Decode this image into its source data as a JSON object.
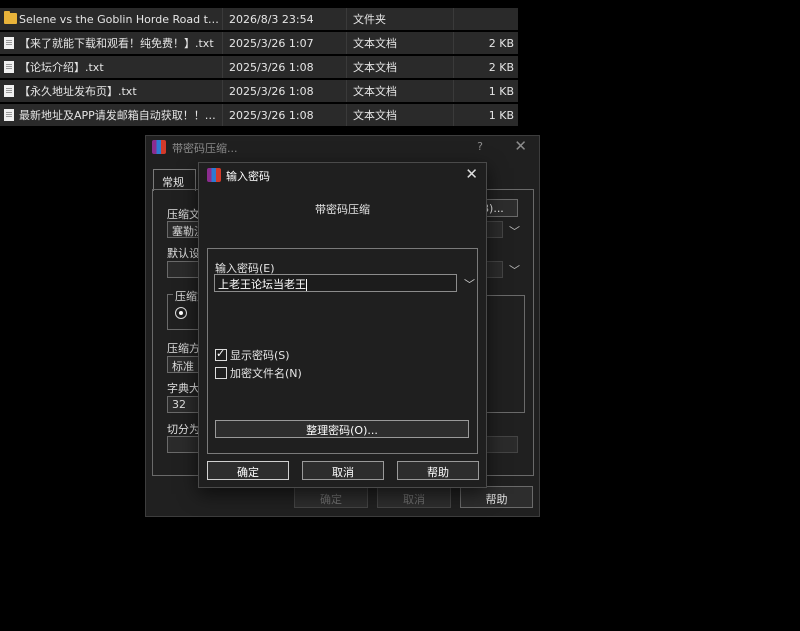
{
  "file_list": [
    {
      "icon": "folder-icon",
      "name": "Selene vs the Goblin Horde Road to ...",
      "date": "2026/8/3 23:54",
      "type": "文件夹",
      "size": ""
    },
    {
      "icon": "text-file-icon",
      "name": "【来了就能下载和观看！纯免费！】.txt",
      "date": "2025/3/26 1:07",
      "type": "文本文档",
      "size": "2 KB"
    },
    {
      "icon": "text-file-icon",
      "name": "【论坛介绍】.txt",
      "date": "2025/3/26 1:08",
      "type": "文本文档",
      "size": "2 KB"
    },
    {
      "icon": "text-file-icon",
      "name": "【永久地址发布页】.txt",
      "date": "2025/3/26 1:08",
      "type": "文本文档",
      "size": "1 KB"
    },
    {
      "icon": "text-file-icon",
      "name": "最新地址及APP请发邮箱自动获取！！！...",
      "date": "2025/3/26 1:08",
      "type": "文本文档",
      "size": "1 KB"
    }
  ],
  "back_dialog": {
    "title": "带密码压缩...",
    "help": "?",
    "close": "✕",
    "tab_general": "常规",
    "label_archive_name": "压缩文",
    "archive_name_value": "塞勒涅",
    "browse_label": "(B)...",
    "label_default": "默认设",
    "label_format": "压缩文",
    "label_method": "压缩方",
    "method_value": "标准",
    "label_dict": "字典大",
    "dict_value": "32",
    "label_split": "切分为",
    "ok": "确定",
    "cancel": "取消",
    "help_button": "帮助"
  },
  "front_dialog": {
    "title": "输入密码",
    "close": "✕",
    "subtitle": "带密码压缩",
    "password_label": "输入密码(E)",
    "password_value": "上老王论坛当老王",
    "show_password": "显示密码(S)",
    "show_password_checked": true,
    "encrypt_names": "加密文件名(N)",
    "encrypt_names_checked": false,
    "manage_button": "整理密码(O)...",
    "ok": "确定",
    "cancel": "取消",
    "help": "帮助"
  }
}
